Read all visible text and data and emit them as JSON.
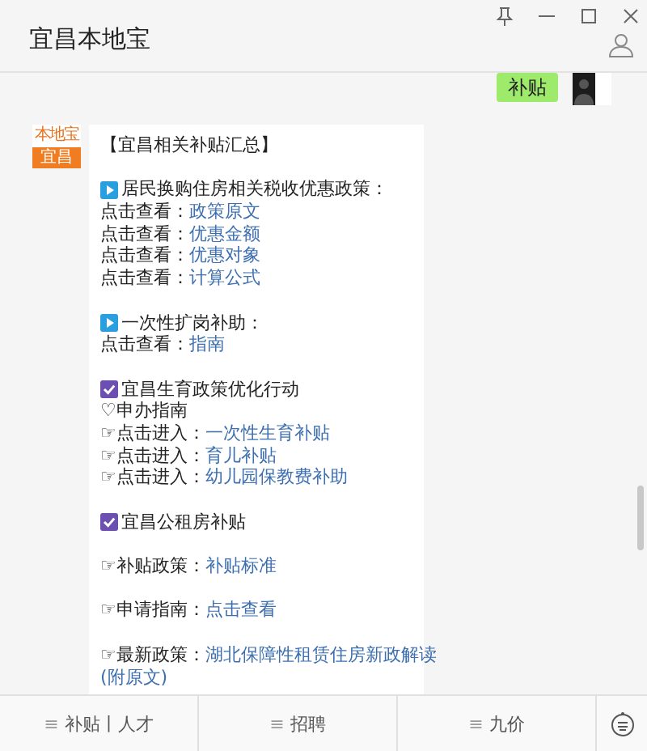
{
  "window": {
    "title": "宜昌本地宝"
  },
  "messages": [
    {
      "kind": "outgoing",
      "text": "补贴"
    },
    {
      "kind": "incoming",
      "logo_top": "本地宝",
      "logo_bottom": "宜昌",
      "lines": [
        {
          "kind": "plain",
          "text": "【宜昌相关补贴汇总】"
        },
        {
          "kind": "blank"
        },
        {
          "kind": "play-heading",
          "text": "居民换购住房相关税收优惠政策："
        },
        {
          "kind": "link-line",
          "text": "点击查看：",
          "link": "政策原文"
        },
        {
          "kind": "link-line",
          "text": "点击查看：",
          "link": "优惠金额"
        },
        {
          "kind": "link-line",
          "text": "点击查看：",
          "link": "优惠对象"
        },
        {
          "kind": "link-line",
          "text": "点击查看：",
          "link": "计算公式"
        },
        {
          "kind": "blank"
        },
        {
          "kind": "play-heading",
          "text": "一次性扩岗补助："
        },
        {
          "kind": "link-line",
          "text": "点击查看：",
          "link": "指南"
        },
        {
          "kind": "blank"
        },
        {
          "kind": "check-heading",
          "text": "宜昌生育政策优化行动"
        },
        {
          "kind": "plain",
          "text": "♡申办指南"
        },
        {
          "kind": "link-line",
          "text": "☞点击进入：",
          "link": "一次性生育补贴"
        },
        {
          "kind": "link-line",
          "text": "☞点击进入：",
          "link": "育儿补贴"
        },
        {
          "kind": "link-line",
          "text": "☞点击进入：",
          "link": "幼儿园保教费补助"
        },
        {
          "kind": "blank"
        },
        {
          "kind": "check-heading",
          "text": "宜昌公租房补贴"
        },
        {
          "kind": "blank"
        },
        {
          "kind": "link-line",
          "text": "☞补贴政策：",
          "link": "补贴标准"
        },
        {
          "kind": "blank"
        },
        {
          "kind": "link-line",
          "text": "☞申请指南：",
          "link": "点击查看"
        },
        {
          "kind": "blank"
        },
        {
          "kind": "link-line",
          "text": "☞最新政策：",
          "link": "湖北保障性租赁住房新政解读"
        },
        {
          "kind": "link-continuation",
          "link": "(附原文)"
        }
      ]
    }
  ],
  "menu": [
    {
      "icon": "≡",
      "label": "补贴丨人才"
    },
    {
      "icon": "≡",
      "label": "招聘"
    },
    {
      "icon": "≡",
      "label": "九价"
    }
  ]
}
